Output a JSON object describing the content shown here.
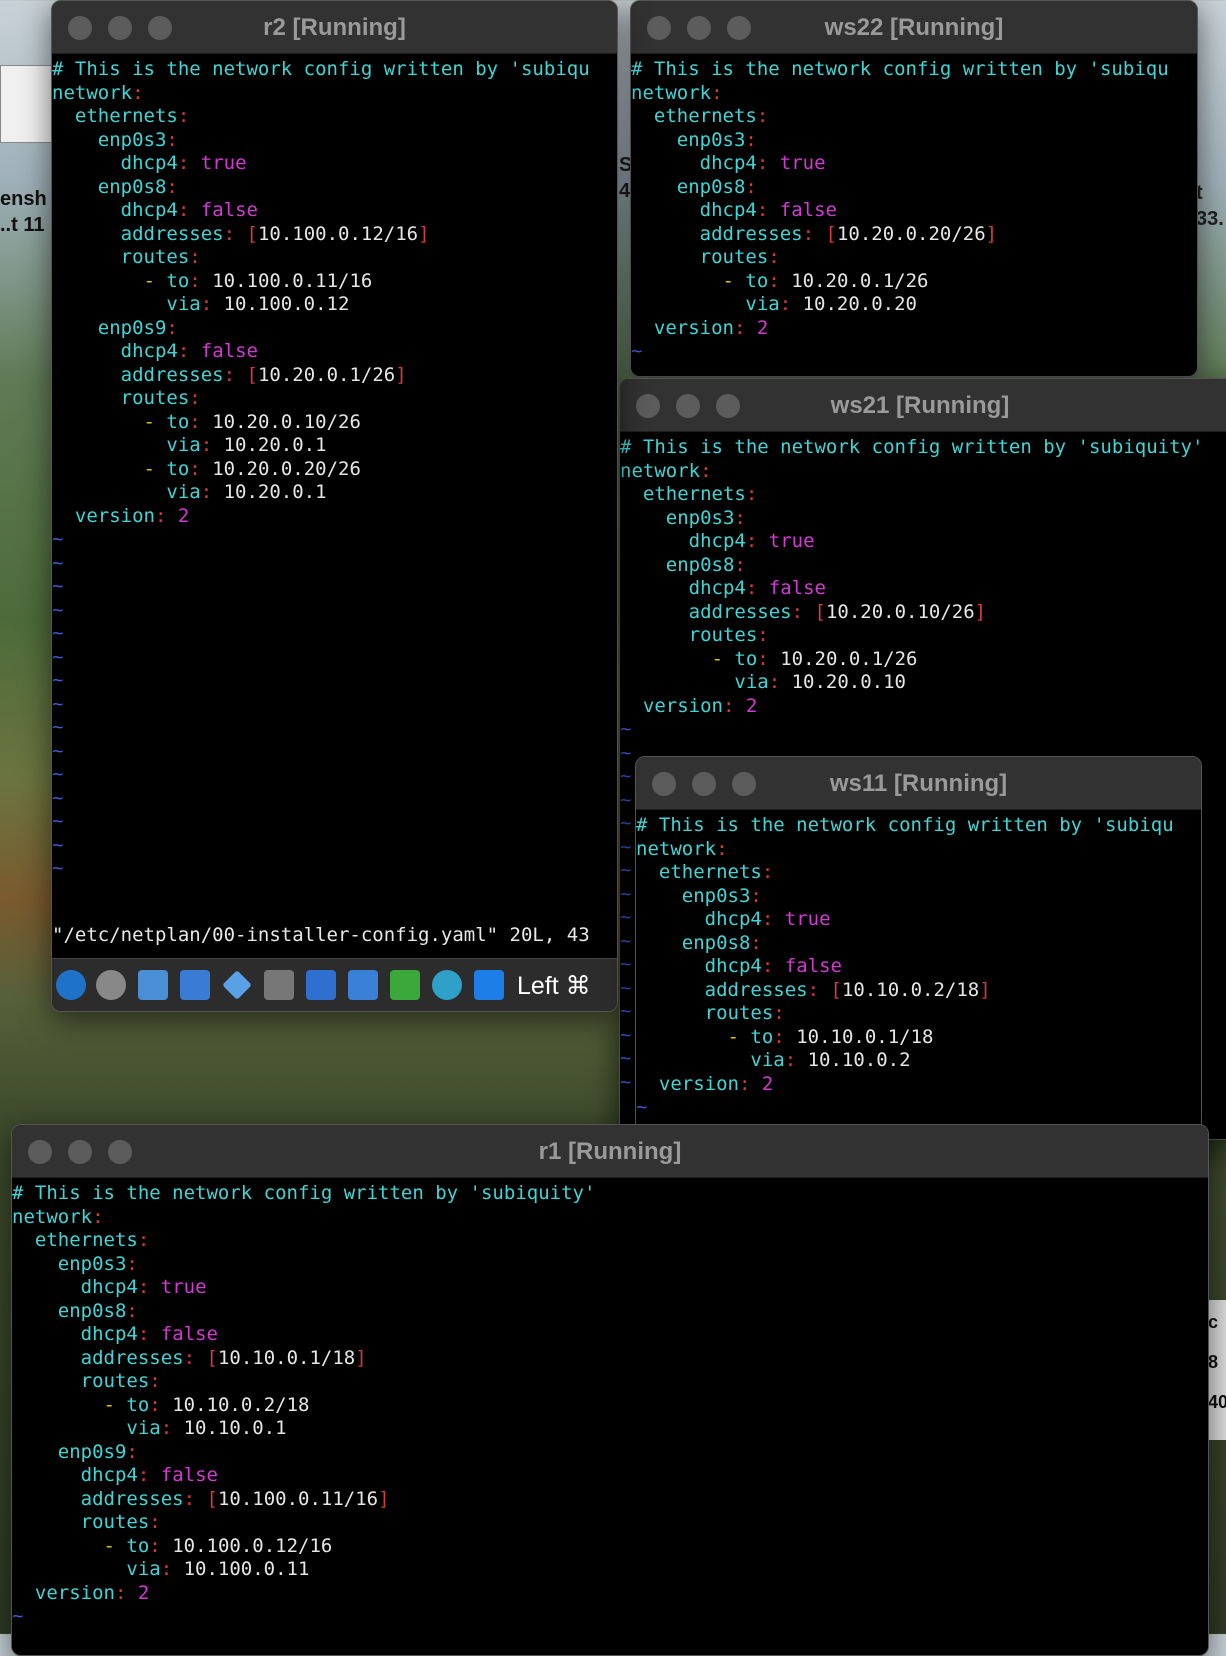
{
  "windows": {
    "r2": {
      "title": "r2 [Running]",
      "lines": [
        [
          "# This is the network config written by 'subiqu"
        ],
        [
          "network:"
        ],
        [
          "  ethernets:"
        ],
        [
          "    enp0s3:"
        ],
        [
          "      dhcp4: true"
        ],
        [
          "    enp0s8:"
        ],
        [
          "      dhcp4: false"
        ],
        [
          "      addresses: [10.100.0.12/16]"
        ],
        [
          "      routes:"
        ],
        [
          "        - to: 10.100.0.11/16"
        ],
        [
          "          via: 10.100.0.12"
        ],
        [
          "    enp0s9:"
        ],
        [
          "      dhcp4: false"
        ],
        [
          "      addresses: [10.20.0.1/26]"
        ],
        [
          "      routes:"
        ],
        [
          "        - to: 10.20.0.10/26"
        ],
        [
          "          via: 10.20.0.1"
        ],
        [
          "        - to: 10.20.0.20/26"
        ],
        [
          "          via: 10.20.0.1"
        ],
        [
          "  version: 2"
        ]
      ],
      "status_line": "\"/etc/netplan/00-installer-config.yaml\" 20L, 43",
      "toolbar_label": "Left ⌘"
    },
    "ws22": {
      "title": "ws22 [Running]",
      "lines": [
        [
          "# This is the network config written by 'subiqu"
        ],
        [
          "network:"
        ],
        [
          "  ethernets:"
        ],
        [
          "    enp0s3:"
        ],
        [
          "      dhcp4: true"
        ],
        [
          "    enp0s8:"
        ],
        [
          "      dhcp4: false"
        ],
        [
          "      addresses: [10.20.0.20/26]"
        ],
        [
          "      routes:"
        ],
        [
          "        - to: 10.20.0.1/26"
        ],
        [
          "          via: 10.20.0.20"
        ],
        [
          "  version: 2"
        ]
      ]
    },
    "ws21": {
      "title": "ws21 [Running]",
      "lines": [
        [
          "# This is the network config written by 'subiquity'"
        ],
        [
          "network:"
        ],
        [
          "  ethernets:"
        ],
        [
          "    enp0s3:"
        ],
        [
          "      dhcp4: true"
        ],
        [
          "    enp0s8:"
        ],
        [
          "      dhcp4: false"
        ],
        [
          "      addresses: [10.20.0.10/26]"
        ],
        [
          "      routes:"
        ],
        [
          "        - to: 10.20.0.1/26"
        ],
        [
          "          via: 10.20.0.10"
        ],
        [
          "  version: 2"
        ]
      ]
    },
    "ws11": {
      "title": "ws11 [Running]",
      "lines": [
        [
          "# This is the network config written by 'subiqu"
        ],
        [
          "network:"
        ],
        [
          "  ethernets:"
        ],
        [
          "    enp0s3:"
        ],
        [
          "      dhcp4: true"
        ],
        [
          "    enp0s8:"
        ],
        [
          "      dhcp4: false"
        ],
        [
          "      addresses: [10.10.0.2/18]"
        ],
        [
          "      routes:"
        ],
        [
          "        - to: 10.10.0.1/18"
        ],
        [
          "          via: 10.10.0.2"
        ],
        [
          "  version: 2"
        ]
      ]
    },
    "r1": {
      "title": "r1 [Running]",
      "lines": [
        [
          "# This is the network config written by 'subiquity'"
        ],
        [
          "network:"
        ],
        [
          "  ethernets:"
        ],
        [
          "    enp0s3:"
        ],
        [
          "      dhcp4: true"
        ],
        [
          "    enp0s8:"
        ],
        [
          "      dhcp4: false"
        ],
        [
          "      addresses: [10.10.0.1/18]"
        ],
        [
          "      routes:"
        ],
        [
          "        - to: 10.10.0.2/18"
        ],
        [
          "          via: 10.10.0.1"
        ],
        [
          "    enp0s9:"
        ],
        [
          "      dhcp4: false"
        ],
        [
          "      addresses: [10.100.0.11/16]"
        ],
        [
          "      routes:"
        ],
        [
          "        - to: 10.100.0.12/16"
        ],
        [
          "          via: 10.100.0.11"
        ],
        [
          "  version: 2"
        ]
      ]
    }
  },
  "desktop_fragments": [
    "ensh",
    "..t 11",
    "S",
    "4",
    "t",
    "33.",
    "c",
    "8",
    "40"
  ],
  "toolbar_icons": [
    "vm-help-icon",
    "optical-disc-icon",
    "network-adapters-icon",
    "shared-folders-icon",
    "usb-icon",
    "folder-icon",
    "display-icon",
    "screen-capture-icon",
    "guest-additions-icon",
    "recording-icon",
    "download-icon"
  ],
  "colors": {
    "comment": "#3ed6d6",
    "punct": "#d73a3a",
    "bool": "#d33ad3",
    "dash": "#e6c200",
    "tilde": "#3a5bd6",
    "title": "#9a9a9a"
  }
}
